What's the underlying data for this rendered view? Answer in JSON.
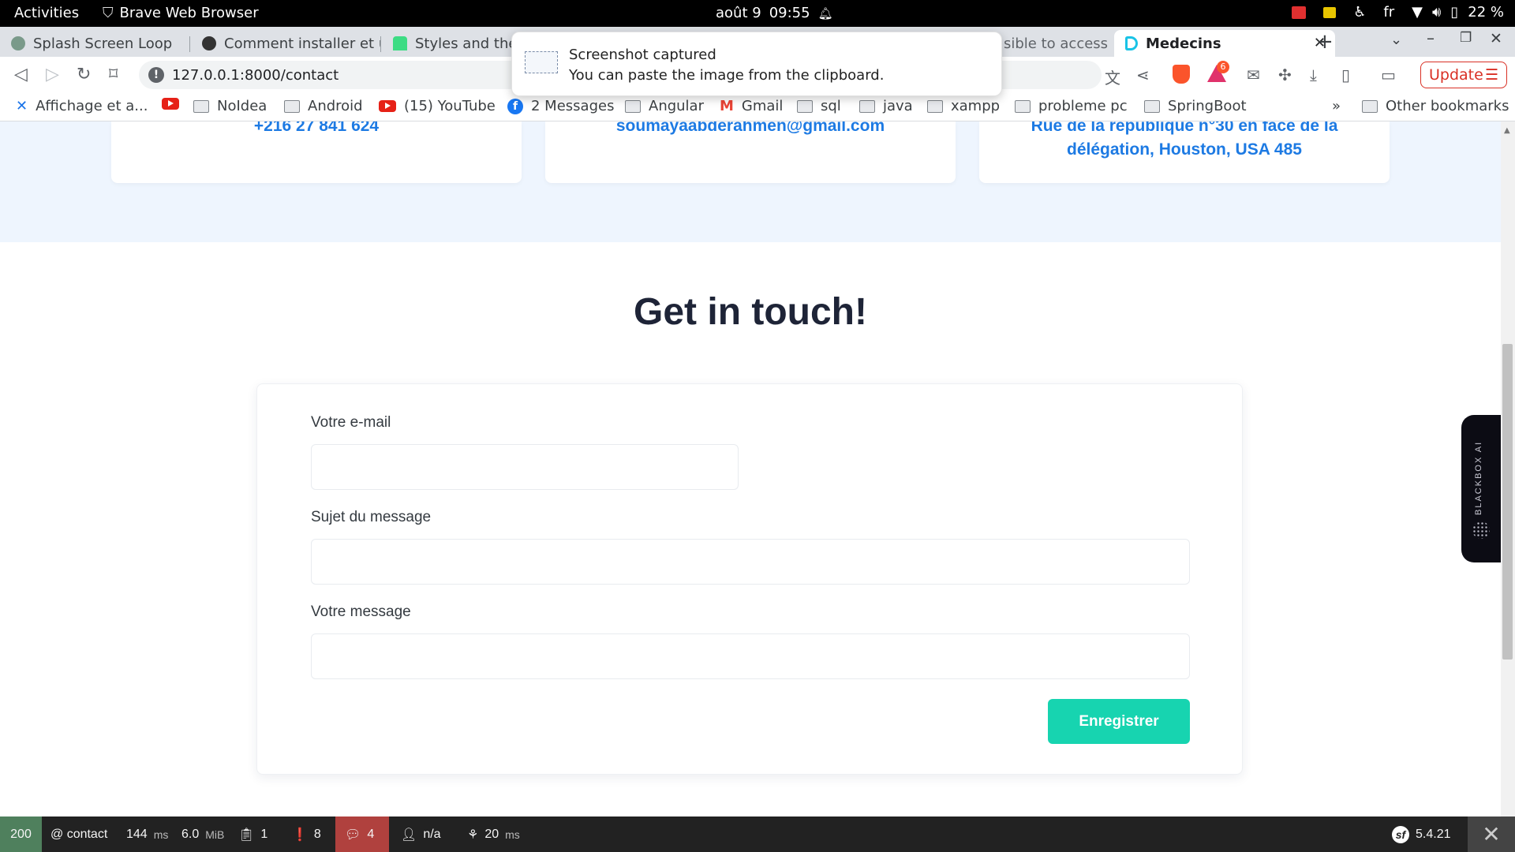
{
  "system": {
    "activities": "Activities",
    "app_name": "Brave Web Browser",
    "date": "août 9",
    "time": "09:55",
    "lang": "fr",
    "battery": "22 %"
  },
  "tabs": [
    {
      "label": "Splash Screen Loop",
      "favicon_color": "#7a9a8a"
    },
    {
      "label": "Comment installer et u",
      "favicon_color": "#333333"
    },
    {
      "label": "Styles and them",
      "favicon_color": "#3ddc84"
    },
    {
      "label": "sible to access a",
      "favicon_color": "#888888"
    },
    {
      "label": "Medecins",
      "favicon_color": "#19c3e6",
      "active": true
    }
  ],
  "toolbar": {
    "url": "127.0.0.1:8000/contact",
    "update_label": "Update",
    "brave_badge": "6"
  },
  "bookmarks": {
    "items": [
      {
        "label": "Affichage et a...",
        "icon": "x-icon"
      },
      {
        "label": "",
        "icon": "youtube-icon"
      },
      {
        "label": "NoIdea",
        "icon": "folder-icon"
      },
      {
        "label": "Android",
        "icon": "folder-icon"
      },
      {
        "label": "(15) YouTube",
        "icon": "youtube-icon"
      },
      {
        "label": "2 Messages",
        "icon": "facebook-icon"
      },
      {
        "label": "Angular",
        "icon": "folder-icon"
      },
      {
        "label": "Gmail",
        "icon": "gmail-icon"
      },
      {
        "label": "sql",
        "icon": "folder-icon"
      },
      {
        "label": "java",
        "icon": "folder-icon"
      },
      {
        "label": "xampp",
        "icon": "folder-icon"
      },
      {
        "label": "probleme pc",
        "icon": "folder-icon"
      },
      {
        "label": "SpringBoot",
        "icon": "folder-icon"
      }
    ],
    "more": "»",
    "other": "Other bookmarks"
  },
  "notification": {
    "title": "Screenshot captured",
    "body": "You can paste the image from the clipboard."
  },
  "contact_cards": {
    "phone": "+216 27 841 624",
    "email": "soumayaabderahmen@gmail.com",
    "address_line1": "Rue de la republique n°30 en face de la",
    "address_line2": "délégation, Houston, USA 485"
  },
  "contact_form": {
    "heading": "Get in touch!",
    "email_label": "Votre e-mail",
    "email_value": "",
    "subject_label": "Sujet du message",
    "subject_value": "",
    "message_label": "Votre message",
    "message_value": "",
    "submit_label": "Enregistrer"
  },
  "blackbox": {
    "label": "BLACKBOX AI"
  },
  "debug_toolbar": {
    "status_code": "200",
    "route": "@ contact",
    "time_value": "144",
    "time_unit": "ms",
    "memory_value": "6.0",
    "memory_unit": "MiB",
    "forms": "1",
    "logs": "8",
    "translations": "4",
    "user": "n/a",
    "render_value": "20",
    "render_unit": "ms",
    "version": "5.4.21"
  },
  "colors": {
    "accent_button": "#17d4b0",
    "link_blue": "#1d7ae3",
    "heading": "#1e2437",
    "band_bg": "#eef5fe",
    "update_red": "#d93025"
  }
}
